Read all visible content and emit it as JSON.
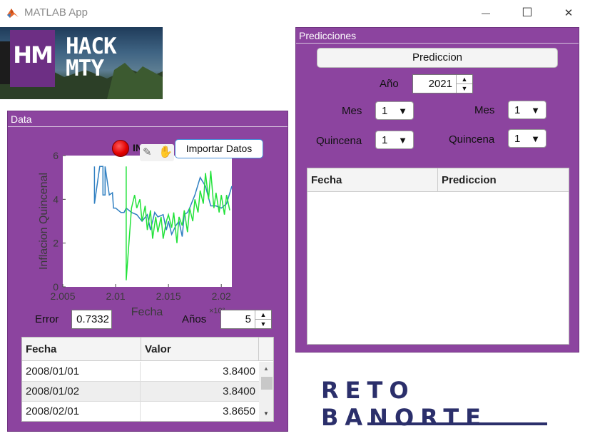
{
  "window": {
    "title": "MATLAB App",
    "minimize_glyph": "—",
    "maximize_glyph": "☐",
    "close_glyph": "✕"
  },
  "logo": {
    "badge": "HM",
    "word_line1": "HACK",
    "word_line2": "MTY"
  },
  "data_panel": {
    "title": "Data",
    "lamp_label": "IN",
    "import_button": "Importar Datos",
    "error_label": "Error",
    "error_value": "0.7332",
    "anios_label": "Años",
    "anios_value": "5",
    "table": {
      "headers": [
        "Fecha",
        "Valor"
      ],
      "rows": [
        [
          "2008/01/01",
          "3.8400"
        ],
        [
          "2008/01/02",
          "3.8400"
        ],
        [
          "2008/02/01",
          "3.8650"
        ]
      ]
    }
  },
  "chart_data": {
    "type": "line",
    "xlabel": "Fecha",
    "ylabel": "Inflacion Quincenal",
    "x_exponent_label": "×10³",
    "xlim": [
      2.005,
      2.021
    ],
    "ylim": [
      0,
      6
    ],
    "x_ticks": [
      "2.005",
      "2.01",
      "2.015",
      "2.02"
    ],
    "y_ticks": [
      "0",
      "2",
      "4",
      "6"
    ],
    "series": [
      {
        "color": "#2f7fc1",
        "x": [
          2.008,
          2.008,
          2.0085,
          2.0088,
          2.0088,
          2.009,
          2.009,
          2.0094,
          2.0097,
          2.0098,
          2.01,
          2.0105,
          2.0108,
          2.011,
          2.0115,
          2.012,
          2.0125,
          2.013,
          2.0133,
          2.0137,
          2.014,
          2.0145,
          2.0148,
          2.015,
          2.0153,
          2.0157,
          2.016,
          2.0163,
          2.0165,
          2.0168,
          2.017,
          2.0175,
          2.018,
          2.0185,
          2.019,
          2.0195,
          2.02,
          2.0205,
          2.021
        ],
        "y": [
          5.5,
          3.8,
          5.5,
          5.5,
          4.2,
          4.2,
          5.5,
          4.2,
          4.3,
          3.6,
          3.6,
          3.4,
          3.4,
          3.6,
          3.4,
          3.3,
          3.0,
          3.3,
          2.6,
          3.4,
          3.2,
          3.3,
          2.6,
          3.0,
          2.4,
          2.8,
          3.0,
          2.3,
          3.3,
          3.4,
          3.6,
          4.2,
          5.0,
          4.6,
          3.7,
          3.7,
          3.6,
          3.8,
          4.6
        ]
      },
      {
        "color": "#22e23a",
        "x": [
          2.011,
          2.011,
          2.0115,
          2.0118,
          2.012,
          2.0123,
          2.0125,
          2.0128,
          2.013,
          2.0133,
          2.0135,
          2.0138,
          2.014,
          2.0143,
          2.0145,
          2.0148,
          2.015,
          2.0153,
          2.0155,
          2.0158,
          2.016,
          2.0163,
          2.0165,
          2.0168,
          2.017,
          2.0173,
          2.0175,
          2.0178,
          2.018,
          2.0183,
          2.0185,
          2.0188,
          2.019,
          2.0193,
          2.0195,
          2.0198,
          2.02,
          2.0203,
          2.0205,
          2.0208
        ],
        "y": [
          5.5,
          0.3,
          3.6,
          4.2,
          3.6,
          4.0,
          3.0,
          3.7,
          2.6,
          3.5,
          2.2,
          3.2,
          2.5,
          3.2,
          2.2,
          3.0,
          3.3,
          2.7,
          3.4,
          2.0,
          3.2,
          2.8,
          3.5,
          2.5,
          3.6,
          3.0,
          4.0,
          3.4,
          4.4,
          3.8,
          5.2,
          4.0,
          5.3,
          3.6,
          4.3,
          3.4,
          4.2,
          3.3,
          4.2,
          3.5
        ]
      }
    ]
  },
  "pred_panel": {
    "title": "Predicciones",
    "button": "Prediccion",
    "anio_label": "Año",
    "anio_value": "2021",
    "mes_label": "Mes",
    "mes_value_left": "1",
    "mes_value_right": "1",
    "quincena_label": "Quincena",
    "quincena_value_left": "1",
    "quincena_value_right": "1",
    "table": {
      "headers": [
        "Fecha",
        "Prediccion"
      ]
    }
  },
  "banner": {
    "text": "RETO BANORTE"
  }
}
